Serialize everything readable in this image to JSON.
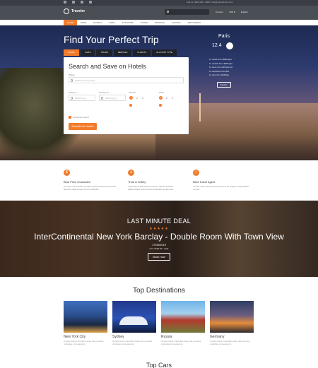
{
  "topbar": {
    "contact": "Call us: (000) 000 - 0000   |   info@yourdomain.com"
  },
  "header": {
    "logo": "Traveler",
    "links": [
      "Account",
      "USD $",
      "English"
    ]
  },
  "nav": {
    "items": [
      "HOME",
      "PAGE",
      "HOTELS",
      "CARS",
      "ACTIVITIES",
      "TOURS",
      "RENTALS",
      "FLIGHTS",
      "MEGA MENU"
    ]
  },
  "hero": {
    "title": "Find Your Perfect Trip",
    "tabs": [
      "HOTEL",
      "CARS",
      "TOURS",
      "RENTALS",
      "FLIGHTS",
      "ALL POST TYPE"
    ],
    "form": {
      "title": "Search and Save on Hotels",
      "where_label": "Where",
      "where_placeholder": "Where are you going",
      "checkin_label": "Check in",
      "checkout_label": "Check out",
      "date_placeholder": "dd/mm/yyyy",
      "rooms_label": "Rooms",
      "adult_label": "Adult",
      "room_values": [
        "1",
        "2",
        "3"
      ],
      "adult_values": [
        "1",
        "2",
        "3"
      ],
      "children_label": "Children",
      "advanced": "Advanced search",
      "submit": "Search for Hotels"
    },
    "weather": {
      "city": "Paris",
      "temp": "12.4"
    },
    "stats": [
      "11 hotels from $68/night",
      "11 rentals from $35/night",
      "11 tours from $21/person",
      "11 activities from $10",
      "11 cars from $15/day"
    ],
    "explore": "Explore"
  },
  "features": [
    {
      "title": "Best Price Guarantee",
      "desc": "Ex fusce elit tincidunt posuere lacus id amet elementum faucibus ullamcorper rutrum pharetra."
    },
    {
      "title": "Trust & Safety",
      "desc": "Imperdiet ac placerat fermentum ultrices facilisis pellentesque sociis cursus vulputate semper dui."
    },
    {
      "title": "Best Travel Agent",
      "desc": "Cursus risus lobortis lacus sed in et sit magnis suspendisse ut cras."
    }
  ],
  "deal": {
    "kicker": "LAST MINUTE DEAL",
    "stars": "★★★★★",
    "title": "InterContinental New York Barclay - Double Room With Town View",
    "date": "17/05/2019",
    "price": "from $190.00 / night",
    "button": "Book now"
  },
  "destinations": {
    "heading": "Top Destinations",
    "items": [
      {
        "name": "New York City",
        "desc": "Cursus fusce imperdiet curae nisl ut lectus vulputate consequat at."
      },
      {
        "name": "Sydney",
        "desc": "Cursus fusce imperdiet curae nisl ut lectus vulputate consequat at."
      },
      {
        "name": "Russia",
        "desc": "Cursus fusce imperdiet curae nisl ut lectus vulputate consequat at."
      },
      {
        "name": "Germany",
        "desc": "Cursus fusce imperdiet curae nisl ut lectus vulputate consequat at."
      }
    ]
  },
  "cars_heading": "Top Cars",
  "colors": {
    "accent": "#f27c2b",
    "header": "#4a4e55",
    "topbar": "#3a3d44"
  }
}
